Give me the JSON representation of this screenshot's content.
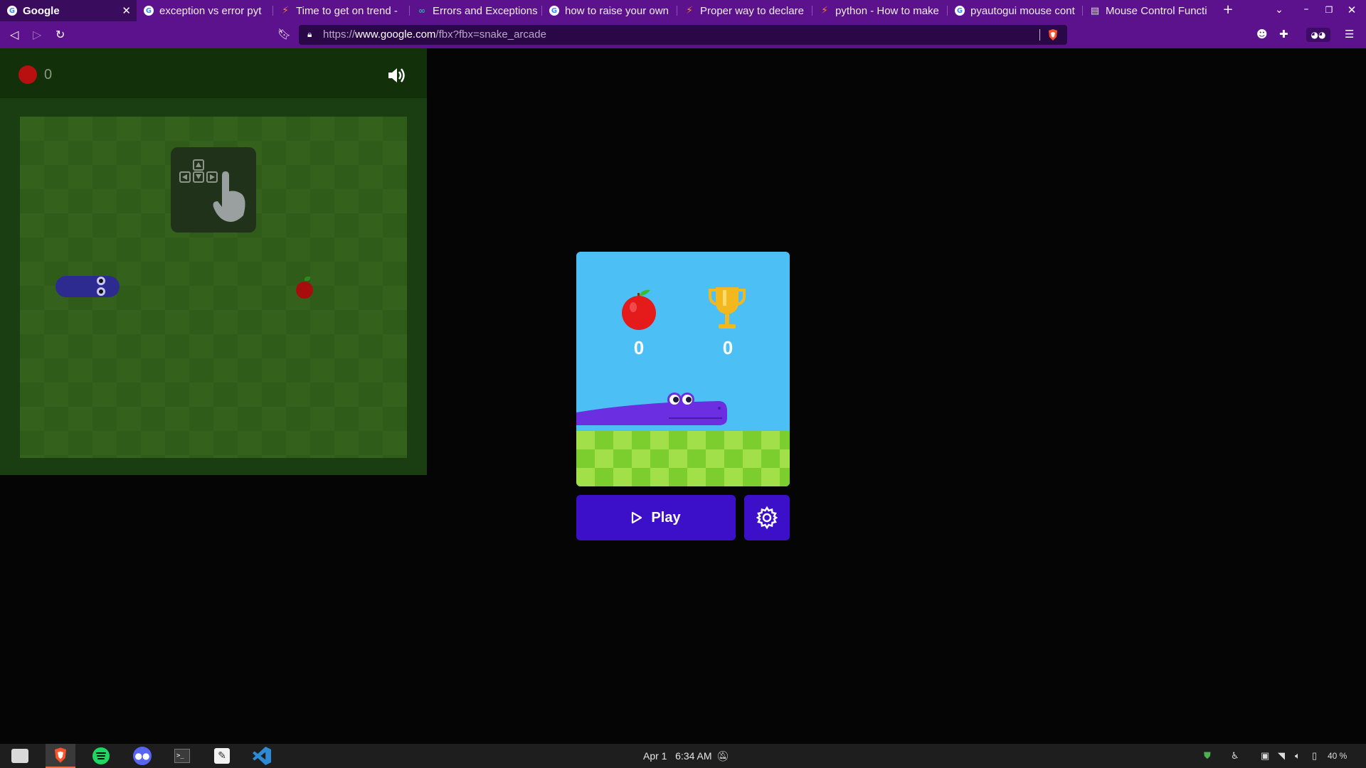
{
  "browser": {
    "tabs": [
      {
        "title": "Google",
        "favicon": "google-icon",
        "active": true
      },
      {
        "title": "exception vs error pyt",
        "favicon": "google-icon"
      },
      {
        "title": "Time to get on trend -",
        "favicon": "stackoverflow-icon"
      },
      {
        "title": "Errors and Exceptions",
        "favicon": "python-docs-icon"
      },
      {
        "title": "how to raise your own",
        "favicon": "google-icon"
      },
      {
        "title": "Proper way to declare",
        "favicon": "stackoverflow-icon"
      },
      {
        "title": "python - How to make",
        "favicon": "stackoverflow-icon"
      },
      {
        "title": "pyautogui mouse cont",
        "favicon": "google-icon"
      },
      {
        "title": "Mouse Control Functi",
        "favicon": "doc-icon"
      }
    ],
    "url_scheme": "https://",
    "url_host": "www.google.com",
    "url_path": "/fbx?fbx=snake_arcade"
  },
  "game": {
    "current_score": "0",
    "card_apple_score": "0",
    "card_trophy_score": "0",
    "play_label": "Play"
  },
  "taskbar": {
    "date": "Apr 1",
    "time": "6:34 AM",
    "battery": "40 %"
  },
  "colors": {
    "browser_chrome": "#5c128d",
    "play_button": "#3c10c8",
    "card_sky": "#4cc0f5"
  }
}
